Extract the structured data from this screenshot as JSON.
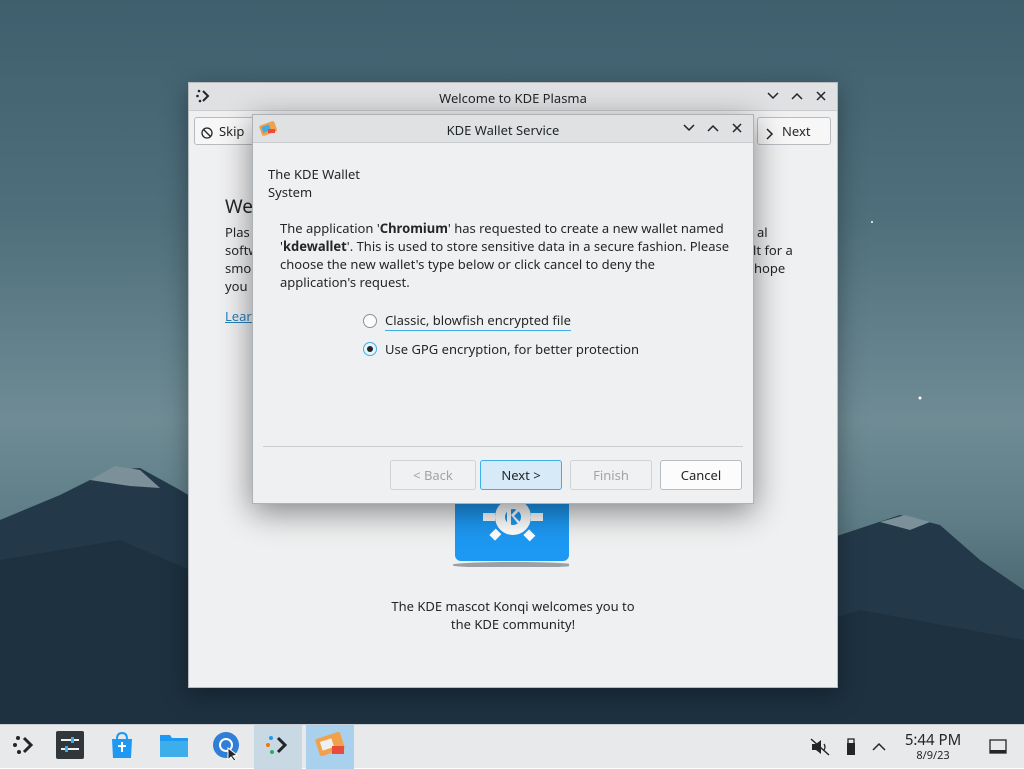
{
  "back_window": {
    "title": "Welcome to KDE Plasma",
    "skip_label": "Skip",
    "next_label": "Next",
    "heading": "We",
    "para_lines": [
      "Plas",
      "softw",
      "smo",
      "you"
    ],
    "right_fragments": [
      "al",
      "ult for a",
      "hope"
    ],
    "link_text": "Lear",
    "mascot_caption": "The KDE mascot Konqi welcomes you to the KDE community!"
  },
  "dialog": {
    "title": "KDE Wallet Service",
    "header": "The KDE Wallet System",
    "message": {
      "p1": "The application '",
      "app": "Chromium",
      "p2": "' has requested to create a new wallet named '",
      "wallet": "kdewallet",
      "p3": "'. This is used to store sensitive data in a secure fashion. Please choose the new wallet's type below or click cancel to deny the application's request."
    },
    "options": [
      {
        "label": "Classic, blowfish encrypted file",
        "checked": false
      },
      {
        "label": "Use GPG encryption, for better protection",
        "checked": true
      }
    ],
    "buttons": {
      "back": "< Back",
      "next": "Next >",
      "finish": "Finish",
      "cancel": "Cancel"
    }
  },
  "taskbar": {
    "clock_time": "5:44 PM",
    "clock_date": "8/9/23",
    "items": [
      "application-launcher",
      "system-settings",
      "discover",
      "dolphin",
      "chromium",
      "welcome-center",
      "kde-wallet"
    ]
  },
  "colors": {
    "accent": "#3daee9",
    "link": "#2980b9",
    "window_bg": "#eff0f1"
  }
}
